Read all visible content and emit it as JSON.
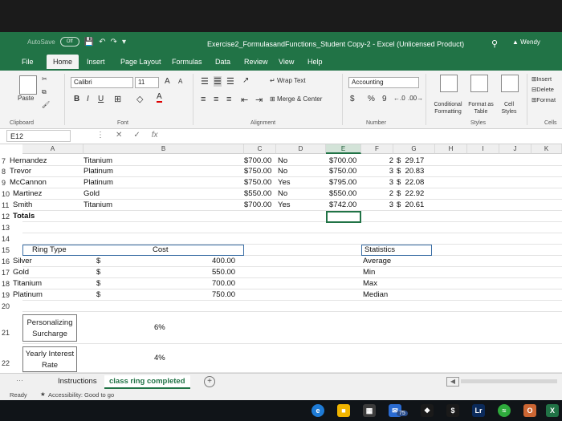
{
  "window": {
    "autosave_label": "AutoSave",
    "autosave_state": "Off",
    "title": "Exercise2_FormulasandFunctions_Student Copy-2  -  Excel (Unlicensed Product)",
    "user": "Wendy"
  },
  "tabs": [
    "File",
    "Home",
    "Insert",
    "Page Layout",
    "Formulas",
    "Data",
    "Review",
    "View",
    "Help"
  ],
  "ribbon": {
    "paste_label": "Paste",
    "clipboard_group": "Clipboard",
    "font_name": "Calibri",
    "font_size": "11",
    "font_group": "Font",
    "bold": "B",
    "italic": "I",
    "underline": "U",
    "wrap_text": "Wrap Text",
    "merge_center": "Merge & Center",
    "alignment_group": "Alignment",
    "number_format": "Accounting",
    "number_group": "Number",
    "conditional_formatting": "Conditional Formatting",
    "format_as_table": "Format as Table",
    "cell_styles": "Cell Styles",
    "styles_group": "Styles",
    "insert": "Insert",
    "delete": "Delete",
    "format": "Format",
    "cells_group": "Cells",
    "currency_symbol": "$",
    "percent_symbol": "%",
    "comma_symbol": "9",
    "font_grow": "A",
    "font_shrink": "A"
  },
  "formula_bar": {
    "name_box": "E12",
    "content": "",
    "fx_label": "fx"
  },
  "columns": [
    "A",
    "B",
    "C",
    "D",
    "E",
    "F",
    "G",
    "H",
    "I",
    "J",
    "K"
  ],
  "rows": {
    "r7": {
      "num": "7",
      "a": "Hernandez",
      "b": "Titanium",
      "c": "$700.00",
      "d": "No",
      "e": "$700.00",
      "f": "2",
      "g": "$  29.17"
    },
    "r8": {
      "num": "8",
      "a": "Trevor",
      "b": "Platinum",
      "c": "$750.00",
      "d": "No",
      "e": "$750.00",
      "f": "3",
      "g": "$  20.83"
    },
    "r9": {
      "num": "9",
      "a": "McCannon",
      "b": "Platinum",
      "c": "$750.00",
      "d": "Yes",
      "e": "$795.00",
      "f": "3",
      "g": "$  22.08"
    },
    "r10": {
      "num": "10",
      "a": "Martinez",
      "b": "Gold",
      "c": "$550.00",
      "d": "No",
      "e": "$550.00",
      "f": "2",
      "g": "$  22.92"
    },
    "r11": {
      "num": "11",
      "a": "Smith",
      "b": "Titanium",
      "c": "$700.00",
      "d": "Yes",
      "e": "$742.00",
      "f": "3",
      "g": "$  20.61"
    },
    "r12": {
      "num": "12",
      "a": "Totals"
    },
    "r13": {
      "num": "13"
    },
    "r14": {
      "num": "14"
    },
    "r15": {
      "num": "15",
      "a": "Ring Type",
      "b": "Cost",
      "f": "Statistics"
    },
    "r16": {
      "num": "16",
      "a": "Silver",
      "b": "$",
      "c": "400.00",
      "f": "Average"
    },
    "r17": {
      "num": "17",
      "a": "Gold",
      "b": "$",
      "c": "550.00",
      "f": "Min"
    },
    "r18": {
      "num": "18",
      "a": "Titanium",
      "b": "$",
      "c": "700.00",
      "f": "Max"
    },
    "r19": {
      "num": "19",
      "a": "Platinum",
      "b": "$",
      "c": "750.00",
      "f": "Median"
    },
    "r20": {
      "num": "20"
    },
    "r21": {
      "num": "21",
      "a": "Personalizing Surcharge",
      "b": "6%"
    },
    "r22": {
      "num": "22",
      "a": "Yearly Interest Rate",
      "b": "4%"
    }
  },
  "sheets": {
    "tabs": [
      "Instructions",
      "class ring completed"
    ],
    "active": "class ring completed",
    "add_symbol": "+"
  },
  "status": {
    "ready": "Ready",
    "accessibility": "Accessibility: Good to go"
  },
  "taskbar": {
    "badge": "75"
  },
  "colors": {
    "excel_green": "#217346",
    "selection": "#217346"
  }
}
